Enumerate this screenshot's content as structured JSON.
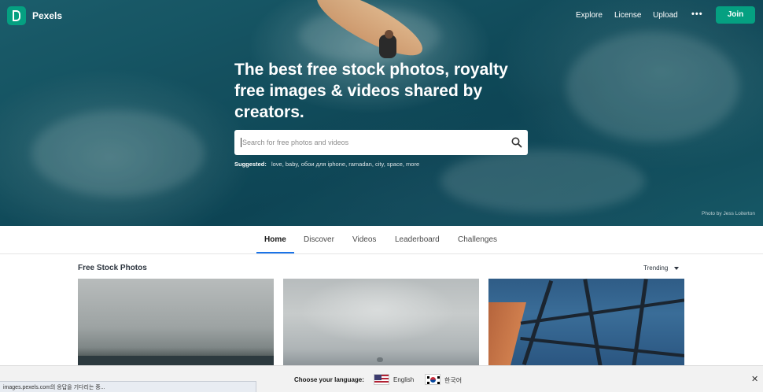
{
  "brand": {
    "name": "Pexels",
    "accent": "#05a081"
  },
  "nav": {
    "links": [
      "Explore",
      "License",
      "Upload"
    ],
    "more": "•••",
    "join": "Join"
  },
  "hero": {
    "headline": "The best free stock photos, royalty free images & videos shared by creators.",
    "search_placeholder": "Search for free photos and videos",
    "suggested_label": "Suggested:",
    "suggested_tags": "love, baby, обои для iphone, ramadan, city, space, more",
    "credit": "Photo by Jess Loiterton"
  },
  "tabs": [
    "Home",
    "Discover",
    "Videos",
    "Leaderboard",
    "Challenges"
  ],
  "active_tab": "Home",
  "content": {
    "section_title": "Free Stock Photos",
    "sort": "Trending"
  },
  "language_bar": {
    "label": "Choose your language:",
    "options": [
      "English",
      "한국어"
    ],
    "close": "✕"
  },
  "status_text": "images.pexels.com의 응답을 기다리는 중..."
}
